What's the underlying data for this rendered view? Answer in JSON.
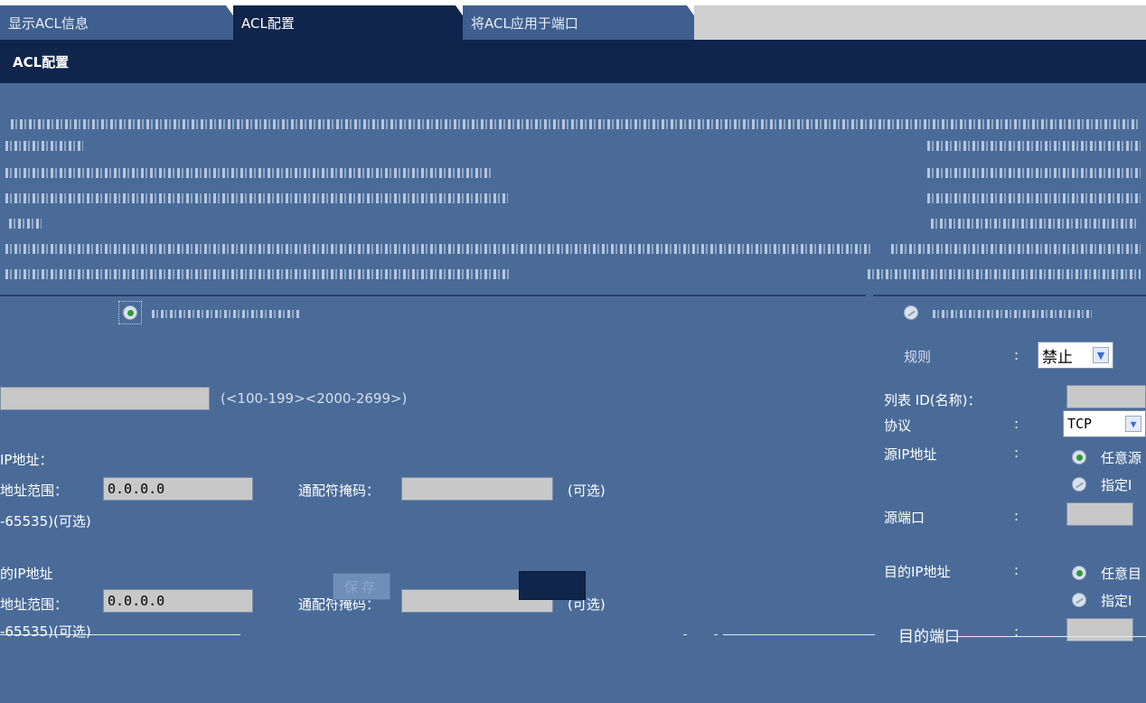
{
  "tabs": [
    {
      "label": "显示ACL信息",
      "state": "inactive"
    },
    {
      "label": "ACL配置",
      "state": "active"
    },
    {
      "label": "将ACL应用于端口",
      "state": "inactive"
    }
  ],
  "panel_title": "ACL配置",
  "left": {
    "list_id_hint": "(<100-199><2000-2699>)",
    "src_ip_section": "IP地址：",
    "src_range_label": "地址范围：",
    "src_range_value": "0.0.0.0",
    "src_wildcard_label": "通配符掩码：",
    "src_optional": "(可选)",
    "src_port_hint": "-65535)(可选)",
    "dst_ip_section": "的IP地址",
    "dst_range_label": "地址范围：",
    "dst_range_value": "0.0.0.0",
    "dst_wildcard_label": "通配符掩码：",
    "dst_optional": "(可选)",
    "dst_port_hint": "-65535)(可选)"
  },
  "right": {
    "rule_label": "规则",
    "rule_colon": ":",
    "rule_value": "禁止",
    "list_id_label": "列表 ID(名称)：",
    "protocol_label": "协议",
    "protocol_colon": ":",
    "protocol_value": "TCP",
    "src_ip_label": "源IP地址",
    "src_ip_colon": ":",
    "src_any": "任意源",
    "src_specific": "指定I",
    "src_port_label": "源端口",
    "src_port_colon": ":",
    "dst_ip_label": "目的IP地址",
    "dst_ip_colon": ":",
    "dst_any": "任意目",
    "dst_specific": "指定I",
    "dst_port_label": "目的端口",
    "dst_port_colon": ":"
  },
  "buttons": {
    "save": "保存"
  },
  "colors": {
    "panel_bg": "#4a6b98",
    "title_bar": "#0f254c",
    "tab_inactive": "#3e5f8f",
    "radio_checked": "#2f9a3a"
  }
}
